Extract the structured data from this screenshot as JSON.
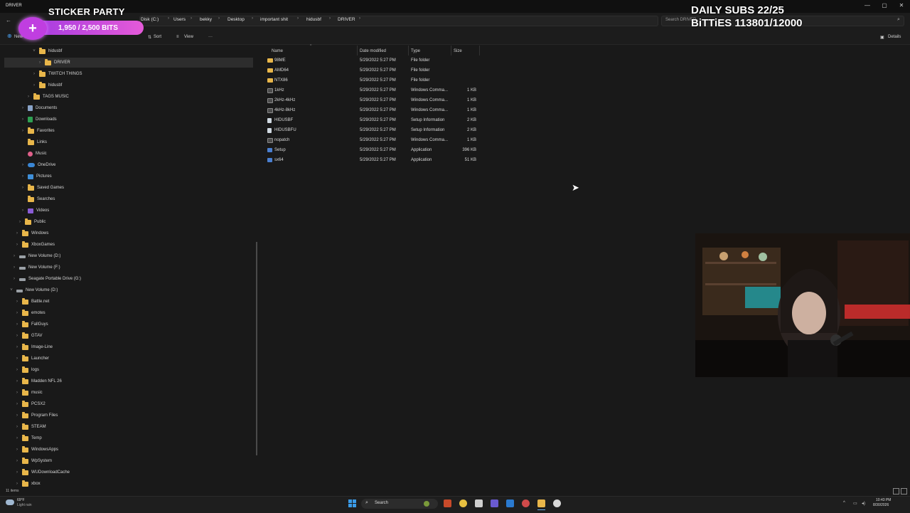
{
  "window": {
    "tab_title": "DRIVER",
    "controls": [
      "—",
      "▢",
      "✕"
    ]
  },
  "address": {
    "breadcrumbs": [
      "Disk (C:)",
      "Users",
      "bekky",
      "Desktop",
      "important shit",
      "hidusbf",
      "DRIVER"
    ],
    "search_placeholder": "Search DRIVER"
  },
  "toolbar": {
    "new_label": "New",
    "sort_label": "Sort",
    "view_label": "View",
    "more_label": "···",
    "details_label": "Details"
  },
  "nav": {
    "items": [
      {
        "label": "hidusbf",
        "indent": 3,
        "icon": "folder",
        "chev": "v"
      },
      {
        "label": "DRIVER",
        "indent": 4,
        "icon": "folder",
        "chev": ">"
      },
      {
        "label": "TWITCH THINGS",
        "indent": 3,
        "icon": "folder",
        "chev": ">"
      },
      {
        "label": "hidusbf",
        "indent": 3,
        "icon": "folder",
        "chev": ">"
      },
      {
        "label": "TAGS MUSIC",
        "indent": 2,
        "icon": "folder",
        "chev": ">"
      },
      {
        "label": "Documents",
        "indent": 1,
        "icon": "docs",
        "chev": ">"
      },
      {
        "label": "Downloads",
        "indent": 1,
        "icon": "dl",
        "chev": ">"
      },
      {
        "label": "Favorites",
        "indent": 1,
        "icon": "folder",
        "chev": ">"
      },
      {
        "label": "Links",
        "indent": 1,
        "icon": "folder",
        "chev": ""
      },
      {
        "label": "Music",
        "indent": 1,
        "icon": "music",
        "chev": ""
      },
      {
        "label": "OneDrive",
        "indent": 1,
        "icon": "cloud",
        "chev": ">"
      },
      {
        "label": "Pictures",
        "indent": 1,
        "icon": "pics",
        "chev": ">"
      },
      {
        "label": "Saved Games",
        "indent": 1,
        "icon": "folder",
        "chev": ">"
      },
      {
        "label": "Searches",
        "indent": 1,
        "icon": "folder",
        "chev": ""
      },
      {
        "label": "Videos",
        "indent": 1,
        "icon": "vids",
        "chev": ">"
      },
      {
        "label": "Public",
        "indent": 0.5,
        "icon": "folder",
        "chev": ">"
      },
      {
        "label": "Windows",
        "indent": 0,
        "icon": "folder",
        "chev": ">"
      },
      {
        "label": "XboxGames",
        "indent": 0,
        "icon": "folder",
        "chev": ">"
      },
      {
        "label": "New Volume (D:)",
        "indent": -0.5,
        "icon": "drive",
        "chev": ">"
      },
      {
        "label": "New Volume (F:)",
        "indent": -0.5,
        "icon": "drive",
        "chev": ">"
      },
      {
        "label": "Seagate Portable Drive (G:)",
        "indent": -0.5,
        "icon": "drive",
        "chev": ">"
      },
      {
        "label": "New Volume (D:)",
        "indent": -1,
        "icon": "drive",
        "chev": "v"
      },
      {
        "label": "Battle.net",
        "indent": 0,
        "icon": "folder",
        "chev": ">"
      },
      {
        "label": "emotes",
        "indent": 0,
        "icon": "folder",
        "chev": ">"
      },
      {
        "label": "FallGuys",
        "indent": 0,
        "icon": "folder",
        "chev": ">"
      },
      {
        "label": "GTAV",
        "indent": 0,
        "icon": "folder",
        "chev": ">"
      },
      {
        "label": "Image-Line",
        "indent": 0,
        "icon": "folder",
        "chev": ">"
      },
      {
        "label": "Launcher",
        "indent": 0,
        "icon": "folder",
        "chev": ">"
      },
      {
        "label": "logs",
        "indent": 0,
        "icon": "folder",
        "chev": ">"
      },
      {
        "label": "Madden NFL 26",
        "indent": 0,
        "icon": "folder",
        "chev": ">"
      },
      {
        "label": "music",
        "indent": 0,
        "icon": "folder",
        "chev": ">"
      },
      {
        "label": "PCSX2",
        "indent": 0,
        "icon": "folder",
        "chev": ">"
      },
      {
        "label": "Program Files",
        "indent": 0,
        "icon": "folder",
        "chev": ">"
      },
      {
        "label": "STEAM",
        "indent": 0,
        "icon": "folder",
        "chev": ">"
      },
      {
        "label": "Temp",
        "indent": 0,
        "icon": "folder",
        "chev": ">"
      },
      {
        "label": "WindowsApps",
        "indent": 0,
        "icon": "folder",
        "chev": ">"
      },
      {
        "label": "WpSystem",
        "indent": 0,
        "icon": "folder",
        "chev": ">"
      },
      {
        "label": "WUDownloadCache",
        "indent": 0,
        "icon": "folder",
        "chev": ">"
      },
      {
        "label": "xbox",
        "indent": 0,
        "icon": "folder",
        "chev": ">"
      }
    ]
  },
  "files": {
    "columns": {
      "name": "Name",
      "date": "Date modified",
      "type": "Type",
      "size": "Size"
    },
    "rows": [
      {
        "name": "98ME",
        "date": "5/29/2022 5:27 PM",
        "type": "File folder",
        "size": "",
        "icon": "folder"
      },
      {
        "name": "AMD64",
        "date": "5/29/2022 5:27 PM",
        "type": "File folder",
        "size": "",
        "icon": "folder"
      },
      {
        "name": "NTX86",
        "date": "5/29/2022 5:27 PM",
        "type": "File folder",
        "size": "",
        "icon": "folder"
      },
      {
        "name": "1kHz",
        "date": "5/29/2022 5:27 PM",
        "type": "Windows Comma...",
        "size": "1 KB",
        "icon": "cmd"
      },
      {
        "name": "2kHz-4kHz",
        "date": "5/29/2022 5:27 PM",
        "type": "Windows Comma...",
        "size": "1 KB",
        "icon": "cmd"
      },
      {
        "name": "4kHz-8kHz",
        "date": "5/29/2022 5:27 PM",
        "type": "Windows Comma...",
        "size": "1 KB",
        "icon": "cmd"
      },
      {
        "name": "HIDUSBF",
        "date": "5/29/2022 5:27 PM",
        "type": "Setup Information",
        "size": "2 KB",
        "icon": "inf"
      },
      {
        "name": "HIDUSBFU",
        "date": "5/29/2022 5:27 PM",
        "type": "Setup Information",
        "size": "2 KB",
        "icon": "inf"
      },
      {
        "name": "nopatch",
        "date": "5/29/2022 5:27 PM",
        "type": "Windows Comma...",
        "size": "1 KB",
        "icon": "cmd"
      },
      {
        "name": "Setup",
        "date": "5/29/2022 5:27 PM",
        "type": "Application",
        "size": "396 KB",
        "icon": "app"
      },
      {
        "name": "sx64",
        "date": "5/29/2022 5:27 PM",
        "type": "Application",
        "size": "51 KB",
        "icon": "app"
      }
    ]
  },
  "status": {
    "item_count": "11 items"
  },
  "taskbar": {
    "weather_temp": "69°F",
    "weather_desc": "Light rain",
    "search_label": "Search",
    "time": "10:43 PM",
    "date": "8/30/2026"
  },
  "overlay": {
    "sticker_title": "STICKER PARTY",
    "sticker_progress": "1,950 / 2,500 BITS",
    "sticker_plus": "+",
    "subs_line": "DAILY SUBS 22/25",
    "bits_line": "BiTTiES 113801/12000"
  },
  "colors": {
    "background": "#191919",
    "folder": "#e8b64a",
    "accent": "#0078d4",
    "sticker_gradient_start": "#a43be0",
    "sticker_gradient_end": "#e55ad9"
  }
}
